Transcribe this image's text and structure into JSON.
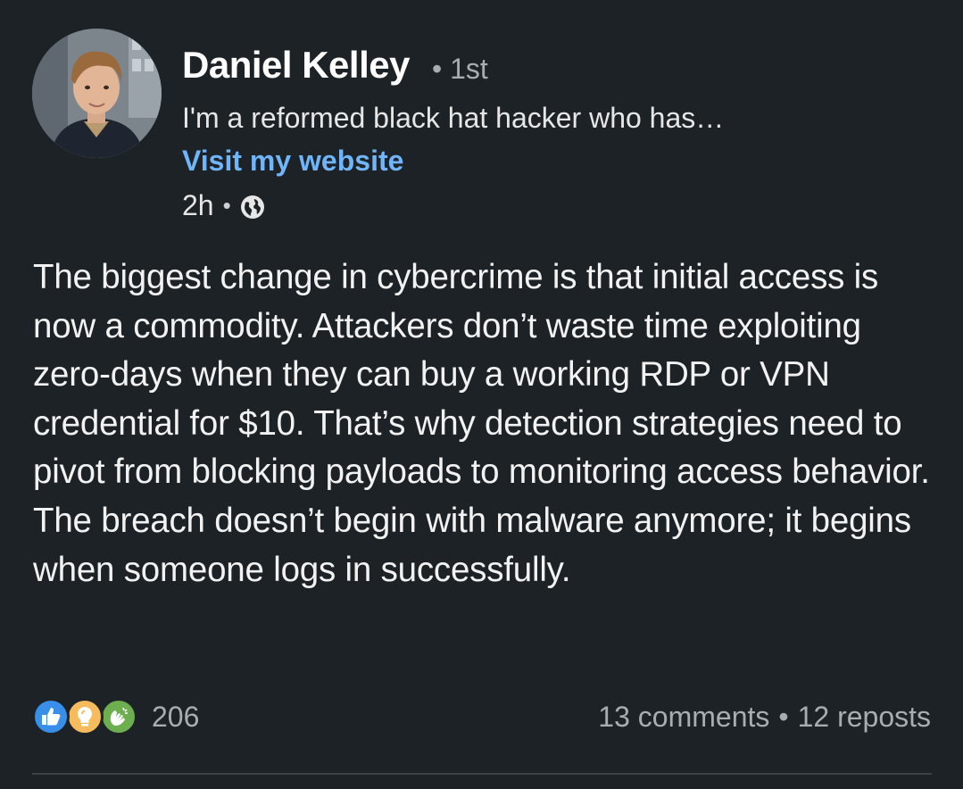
{
  "author": {
    "name": "Daniel Kelley",
    "degree": "• 1st",
    "headline": "I'm a reformed black hat hacker who has…",
    "website_link": "Visit my website",
    "time_ago": "2h",
    "visibility_icon": "globe-icon"
  },
  "post": {
    "text": "The biggest change in cybercrime is that initial access is now a commodity. Attackers don’t waste time exploiting zero-days when they can buy a working RDP or VPN credential for $10. That’s why detection strategies need to pivot from blocking payloads to monitoring access behavior. The breach doesn’t begin with malware anymore; it begins when someone logs in successfully."
  },
  "social": {
    "reaction_icons": [
      "like-icon",
      "insightful-icon",
      "celebrate-icon"
    ],
    "reaction_count": "206",
    "comments": "13 comments",
    "separator": "•",
    "reposts": "12 reposts"
  },
  "colors": {
    "background": "#1d2226",
    "link": "#70b5f9",
    "muted": "#a8adb2",
    "like": "#378fe9",
    "insightful": "#f5bb5c",
    "celebrate": "#6dae4f"
  }
}
